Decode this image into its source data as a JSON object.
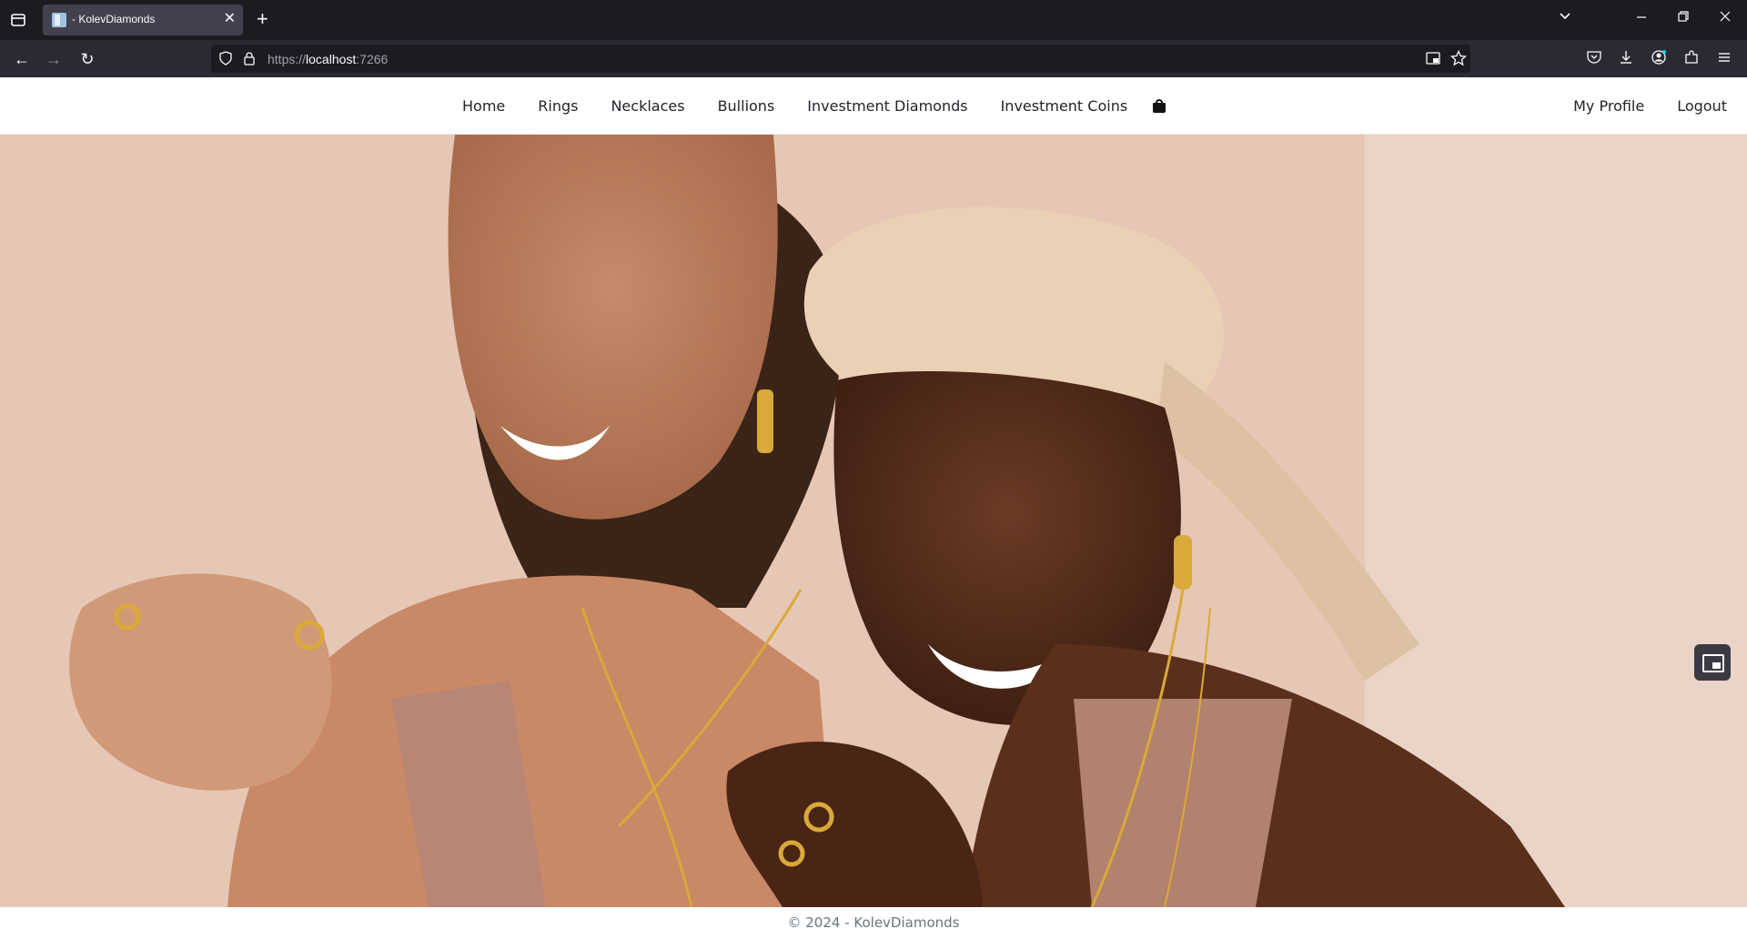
{
  "browser": {
    "tab_title": "- KolevDiamonds",
    "url_scheme": "https://",
    "url_host": "localhost",
    "url_port": ":7266"
  },
  "site": {
    "nav": [
      "Home",
      "Rings",
      "Necklaces",
      "Bullions",
      "Investment Diamonds",
      "Investment Coins"
    ],
    "cart_icon": "shopping-bag-icon",
    "my_profile": "My Profile",
    "logout": "Logout",
    "footer": "© 2024 - KolevDiamonds"
  }
}
